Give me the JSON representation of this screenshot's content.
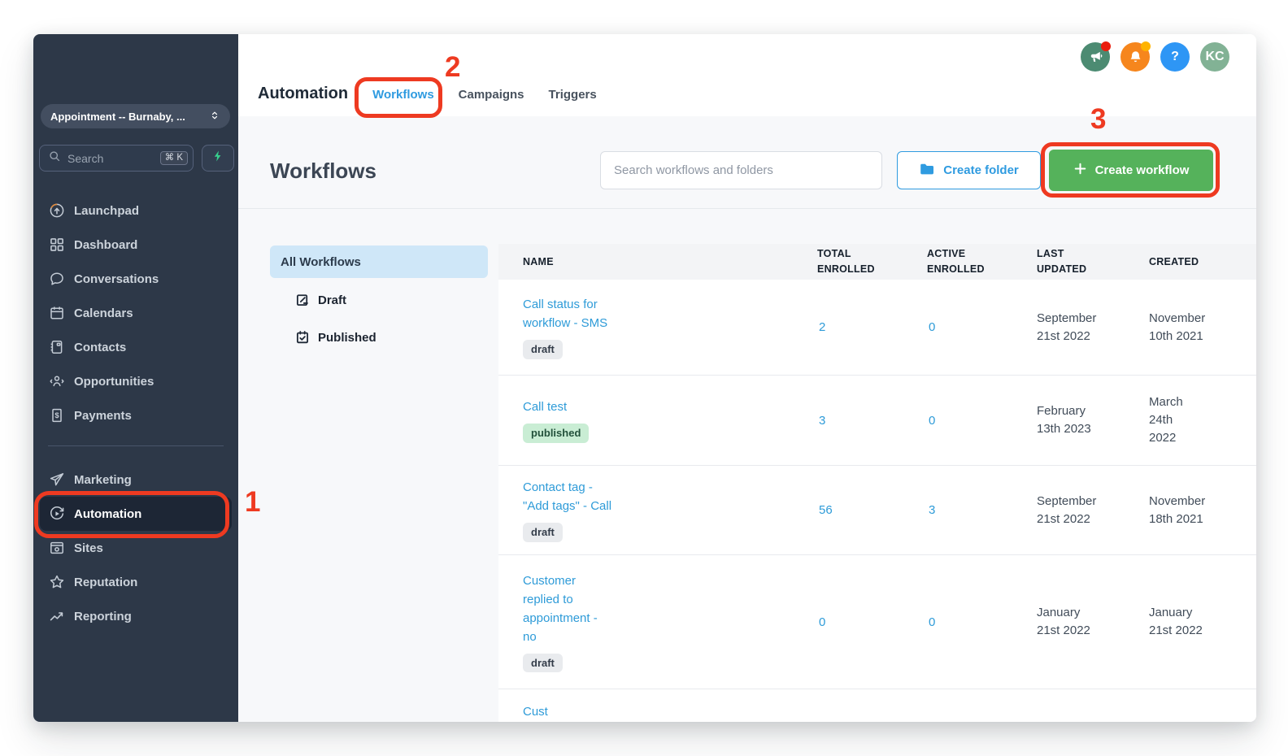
{
  "sidebar": {
    "location_dropdown": {
      "label": "Appointment -- Burnaby, ..."
    },
    "search": {
      "placeholder": "Search",
      "shortcut": "⌘ K"
    },
    "items_top": [
      {
        "label": "Launchpad",
        "icon": "launchpad",
        "active": false
      },
      {
        "label": "Dashboard",
        "icon": "dashboard",
        "active": false
      },
      {
        "label": "Conversations",
        "icon": "conversations",
        "active": false
      },
      {
        "label": "Calendars",
        "icon": "calendars",
        "active": false
      },
      {
        "label": "Contacts",
        "icon": "contacts",
        "active": false
      },
      {
        "label": "Opportunities",
        "icon": "opportunities",
        "active": false
      },
      {
        "label": "Payments",
        "icon": "payments",
        "active": false
      }
    ],
    "items_bottom": [
      {
        "label": "Marketing",
        "icon": "marketing",
        "active": false
      },
      {
        "label": "Automation",
        "icon": "automation",
        "active": true
      },
      {
        "label": "Sites",
        "icon": "sites",
        "active": false
      },
      {
        "label": "Reputation",
        "icon": "reputation",
        "active": false
      },
      {
        "label": "Reporting",
        "icon": "reporting",
        "active": false
      }
    ]
  },
  "topbar": {
    "title": "Automation",
    "tabs": [
      {
        "label": "Workflows",
        "active": true
      },
      {
        "label": "Campaigns",
        "active": false
      },
      {
        "label": "Triggers",
        "active": false
      }
    ],
    "icons": [
      {
        "name": "announcements",
        "glyph": "megaphone",
        "bg": "#4c8b72",
        "dot": "#ea1d0d"
      },
      {
        "name": "notifications",
        "glyph": "bell",
        "bg": "#f6861d",
        "dot": "#ffb301"
      },
      {
        "name": "help",
        "label": "?",
        "bg": "#2e96f5"
      },
      {
        "name": "user-avatar",
        "label": "KC",
        "bg": "#82b295"
      }
    ]
  },
  "page": {
    "title": "Workflows",
    "search_placeholder": "Search workflows and folders",
    "create_folder": "Create folder",
    "create_workflow": "Create workflow",
    "filters": {
      "all_label": "All Workflows",
      "items": [
        {
          "label": "Draft",
          "icon": "draft"
        },
        {
          "label": "Published",
          "icon": "published"
        }
      ]
    },
    "table": {
      "headers": [
        "NAME",
        "TOTAL ENROLLED",
        "ACTIVE ENROLLED",
        "LAST UPDATED",
        "CREATED"
      ],
      "rows": [
        {
          "name": "Call status for\nworkflow - SMS",
          "status": "draft",
          "total": "2",
          "active": "0",
          "updated": "September\n21st 2022",
          "created": "November\n10th 2021"
        },
        {
          "name": "Call test",
          "status": "published",
          "total": "3",
          "active": "0",
          "updated": "February\n13th 2023",
          "created": "March\n24th\n2022"
        },
        {
          "name": "Contact tag -\n\"Add tags\" - Call",
          "status": "draft",
          "total": "56",
          "active": "3",
          "updated": "September\n21st 2022",
          "created": "November\n18th 2021"
        },
        {
          "name": "Customer\nreplied to\nappointment -\nno",
          "status": "draft",
          "total": "0",
          "active": "0",
          "updated": "January\n21st 2022",
          "created": "January\n21st 2022"
        },
        {
          "name": "Cust",
          "status": null,
          "total": "",
          "active": "",
          "updated": "",
          "created": "",
          "partial": true
        }
      ]
    }
  },
  "annotations": {
    "color": "#ee3a21",
    "steps": [
      "1",
      "2",
      "3"
    ]
  },
  "colors": {
    "sidebar_bg": "#2d3848",
    "accent_blue": "#2f9be0",
    "green_button": "#55b25b",
    "annotation_red": "#ee3a21",
    "selected_filter_bg": "#cfe7f8",
    "published_badge_bg": "#c9edd4",
    "draft_badge_bg": "#e9ebee"
  }
}
